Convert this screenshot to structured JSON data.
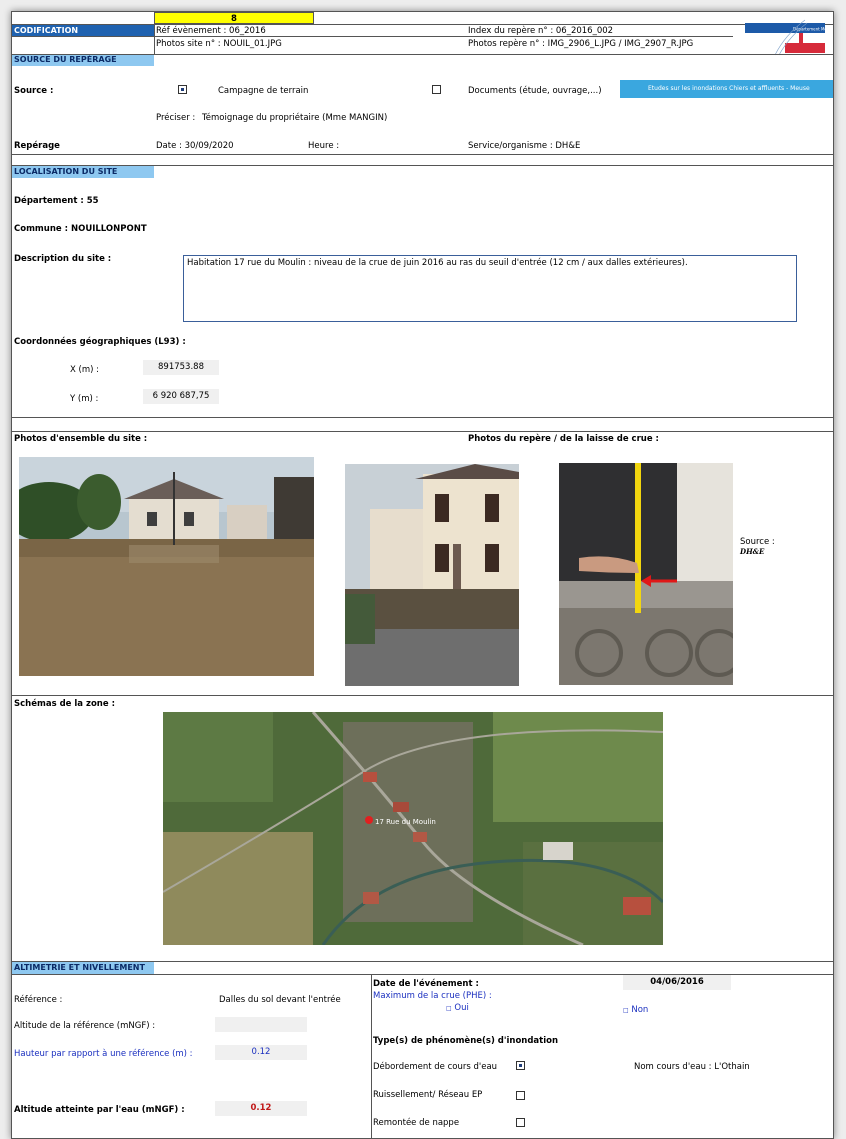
{
  "header": {
    "number": "8",
    "codification": "CODIFICATION",
    "ref_event": "Réf évènement : 06_2016",
    "photos_site": "Photos site n° : NOUIL_01.JPG",
    "index_repere": "Index du repère n° : 06_2016_002",
    "photos_repere": "Photos repère n° : IMG_2906_L.JPG / IMG_2907_R.JPG",
    "logo_text": "Département de la Meuse"
  },
  "source_section": {
    "title": "SOURCE DU REPÉRAGE",
    "source_label": "Source :",
    "campagne_label": "Campagne de terrain",
    "campagne_checked": true,
    "documents_label": "Documents (étude, ouvrage,...)",
    "documents_checked": false,
    "study_banner": "Etudes sur les inondations Chiers et affluents - Meuse",
    "preciser_label": "Préciser :",
    "preciser_value": "Témoignage du propriétaire (Mme MANGIN)",
    "reperage_label": "Repérage",
    "date": "Date : 30/09/2020",
    "heure": "Heure :",
    "service": "Service/organisme : DH&E"
  },
  "localisation": {
    "title": "LOCALISATION DU SITE",
    "departement": "Département :  55",
    "commune": "Commune : NOUILLONPONT",
    "description_label": "Description du site :",
    "description_text": "Habitation 17 rue du Moulin : niveau de la crue de juin 2016 au ras du seuil d'entrée (12 cm / aux dalles extérieures).",
    "coords_label": "Coordonnées géographiques (L93) :",
    "x_label": "X (m) :",
    "x_value": "891753.88",
    "y_label": "Y (m) :",
    "y_value": "6 920 687,75"
  },
  "photos": {
    "ensemble_label": "Photos d'ensemble du site :",
    "repere_label": "Photos du repère / de la laisse de crue  :",
    "source_label": "Source :",
    "source_value": "DH&E"
  },
  "schemas": {
    "label": "Schémas de la zone :",
    "map_label": "17 Rue du Moulin"
  },
  "altimetrie": {
    "title": "ALTIMETRIE ET NIVELLEMENT",
    "reference_label": "Référence :",
    "reference_value": "Dalles du sol devant l'entrée",
    "altitude_ref_label": "Altitude de la référence (mNGF)  :",
    "altitude_ref_value": "",
    "hauteur_label": "Hauteur par rapport à une référence (m) :",
    "hauteur_value": "0.12",
    "altitude_eau_label": "Altitude atteinte par l'eau (mNGF) :",
    "altitude_eau_value": "0.12",
    "date_event_label": "Date de l'événement :",
    "date_event_value": "04/06/2016",
    "max_crue_label": "Maximum de la crue (PHE) :",
    "oui_label": "Oui",
    "non_label": "Non",
    "types_label": "Type(s) de phénomène(s) d'inondation",
    "debordement_label": "Débordement de cours d'eau",
    "debordement_checked": true,
    "nom_cours": "Nom cours d'eau : L'Othain",
    "ruissellement_label": "Ruissellement/ Réseau EP",
    "ruissellement_checked": false,
    "remontee_label": "Remontée de nappe",
    "remontee_checked": false
  },
  "colors": {
    "section_header": "#8ec8f0",
    "codification_bg": "#1f62b0",
    "number_bg": "#ffff00",
    "blue_text": "#1a2fbf",
    "red_text": "#c01818"
  }
}
